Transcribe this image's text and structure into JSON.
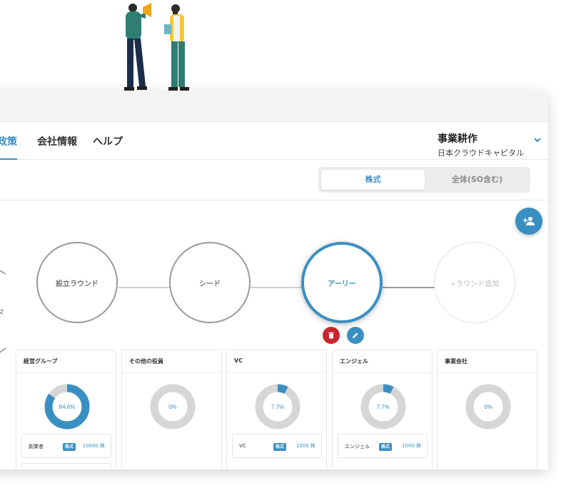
{
  "nav": {
    "items": [
      {
        "label": "政策",
        "active": true
      },
      {
        "label": "会社情報",
        "active": false
      },
      {
        "label": "ヘルプ",
        "active": false
      }
    ],
    "user_name": "事業耕作",
    "company_name": "日本クラウドキャピタル"
  },
  "toggle": {
    "stocks_label": "株式",
    "all_label": "全体(SO含む)"
  },
  "left_hint": "ド",
  "rounds": [
    {
      "label": "設立ラウンド",
      "state": "normal"
    },
    {
      "label": "シード",
      "state": "normal"
    },
    {
      "label": "アーリー",
      "state": "active"
    },
    {
      "label": "+ラウンド追加",
      "state": "add"
    }
  ],
  "groups": [
    {
      "title": "経営グループ",
      "percent": 84.6,
      "percent_label": "84.6%",
      "holder": {
        "name": "創業者",
        "badge": "株式",
        "amount": "10000 株"
      }
    },
    {
      "title": "その他の役員",
      "percent": 0,
      "percent_label": "0%",
      "holder": null
    },
    {
      "title": "VC",
      "percent": 7.7,
      "percent_label": "7.7%",
      "holder": {
        "name": "VC",
        "badge": "株式",
        "amount": "1000 株"
      }
    },
    {
      "title": "エンジェル",
      "percent": 7.7,
      "percent_label": "7.7%",
      "holder": {
        "name": "エンジェル",
        "badge": "株式",
        "amount": "1000 株"
      }
    },
    {
      "title": "事業会社",
      "percent": 0,
      "percent_label": "0%",
      "holder": null
    }
  ],
  "colors": {
    "accent": "#3a8fc2",
    "danger": "#c9252c",
    "donut_track": "#d6d6d6"
  },
  "icons": {
    "add_member": "add-person-icon",
    "delete": "trash-icon",
    "edit": "pencil-icon",
    "dropdown": "chevron-down-icon"
  }
}
